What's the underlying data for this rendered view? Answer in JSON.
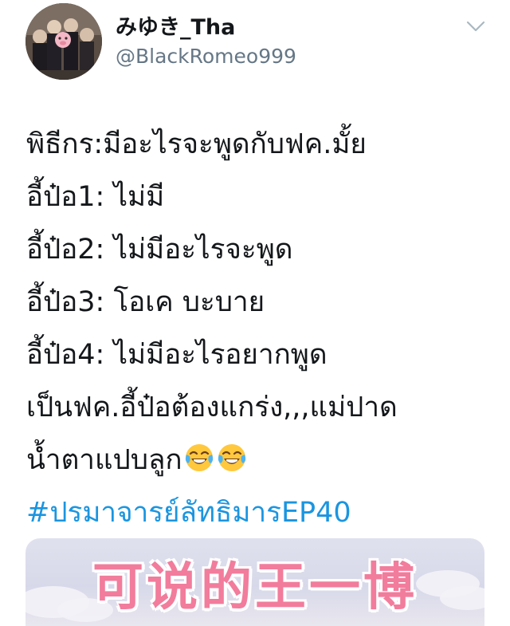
{
  "tweet": {
    "display_name": "みゆき_Tha",
    "handle": "@BlackRomeo999",
    "lines": [
      "พิธีกร:มีอะไรจะพูดกับฟค.มั้ย",
      "อี้ป๋อ1: ไม่มี",
      "อี้ป๋อ2: ไม่มีอะไรจะพูด",
      "อี้ป๋อ3: โอเค บะบาย",
      "อี้ป๋อ4: ไม่มีอะไรอยากพูด",
      "เป็นฟค.อี้ป๋อต้องแกร่ง,,,แม่ปาด",
      "น้ำตาแปบลูก"
    ],
    "emoji": "face-with-tears-of-joy",
    "hashtag": "#ปรมาจารย์ลัทธิมารEP40"
  },
  "media": {
    "caption_text": "可说的王一博"
  },
  "icons": {
    "menu": "chevron-down-icon",
    "avatar": "avatar",
    "emoji_icon": "tears-of-joy-emoji-icon"
  },
  "colors": {
    "text": "#14171a",
    "secondary": "#657786",
    "link": "#1b95e0",
    "media_text": "#f27c9c"
  }
}
